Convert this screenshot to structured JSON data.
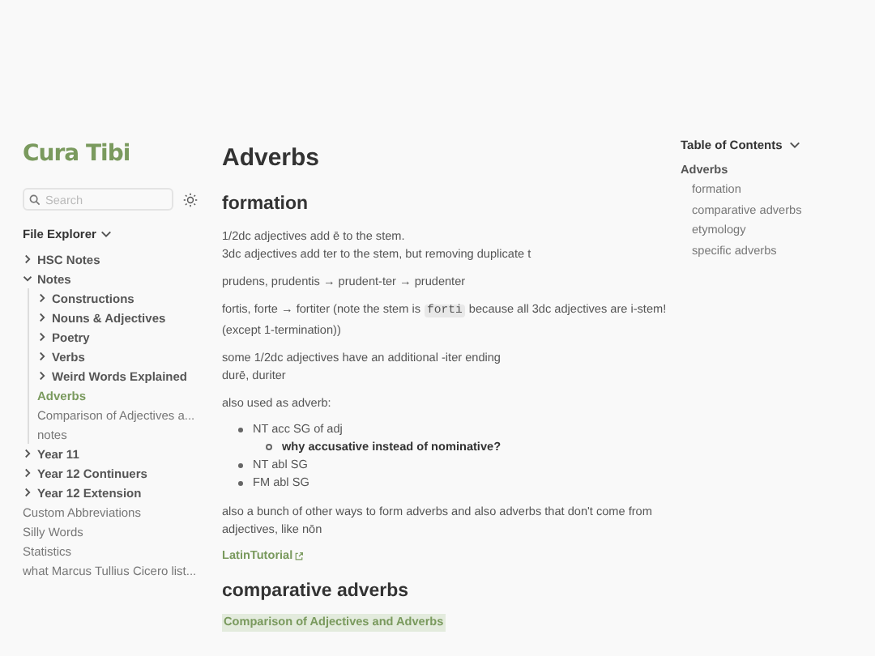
{
  "sidebar": {
    "logo": "Cura Tibi",
    "search": {
      "placeholder": "Search"
    },
    "explorer_title": "File Explorer",
    "tree": [
      {
        "label": "HSC Notes",
        "kind": "folder",
        "expanded": false,
        "selected": false
      },
      {
        "label": "Notes",
        "kind": "folder",
        "expanded": true,
        "selected": false,
        "children": [
          {
            "label": "Constructions",
            "kind": "folder",
            "expanded": false,
            "selected": false
          },
          {
            "label": "Nouns & Adjectives",
            "kind": "folder",
            "expanded": false,
            "selected": false
          },
          {
            "label": "Poetry",
            "kind": "folder",
            "expanded": false,
            "selected": false
          },
          {
            "label": "Verbs",
            "kind": "folder",
            "expanded": false,
            "selected": false
          },
          {
            "label": "Weird Words Explained",
            "kind": "folder",
            "expanded": false,
            "selected": false
          },
          {
            "label": "Adverbs",
            "kind": "file",
            "selected": true
          },
          {
            "label": "Comparison of Adjectives a...",
            "kind": "file",
            "selected": false
          },
          {
            "label": "notes",
            "kind": "file",
            "selected": false
          }
        ]
      },
      {
        "label": "Year 11",
        "kind": "folder",
        "expanded": false,
        "selected": false
      },
      {
        "label": "Year 12 Continuers",
        "kind": "folder",
        "expanded": false,
        "selected": false
      },
      {
        "label": "Year 12 Extension",
        "kind": "folder",
        "expanded": false,
        "selected": false
      },
      {
        "label": "Custom Abbreviations",
        "kind": "file",
        "selected": false
      },
      {
        "label": "Silly Words",
        "kind": "file",
        "selected": false
      },
      {
        "label": "Statistics",
        "kind": "file",
        "selected": false
      },
      {
        "label": "what Marcus Tullius Cicero list...",
        "kind": "file",
        "selected": false
      }
    ]
  },
  "article": {
    "title": "Adverbs",
    "blocks": [
      {
        "kind": "heading",
        "text": "formation"
      },
      {
        "kind": "para",
        "lines": [
          "1/2dc adjectives add ē to the stem.",
          "3dc adjectives add ter to the stem, but removing duplicate t"
        ]
      },
      {
        "kind": "para",
        "lines": [
          "prudens, prudentis → prudent-ter → prudenter"
        ]
      },
      {
        "kind": "code_para",
        "before": "fortis, forte → fortiter (note the stem is ",
        "code": "forti",
        "after": " because all 3dc adjectives are i-stem! (except 1-termination))"
      },
      {
        "kind": "para",
        "lines": [
          "some 1/2dc adjectives have an additional -iter ending",
          "durē, duriter"
        ]
      },
      {
        "kind": "para",
        "lines": [
          "also used as adverb:"
        ]
      },
      {
        "kind": "list",
        "items": [
          {
            "text": "NT acc SG of adj",
            "children": [
              {
                "text": "why accusative instead of nominative?"
              }
            ]
          },
          {
            "text": "NT abl SG"
          },
          {
            "text": "FM abl SG"
          }
        ]
      },
      {
        "kind": "para",
        "lines": [
          "also a bunch of other ways to form adverbs and also adverbs that don't come from adjectives, like nōn"
        ]
      },
      {
        "kind": "external_link",
        "text": "LatinTutorial"
      },
      {
        "kind": "heading",
        "text": "comparative adverbs"
      },
      {
        "kind": "internal_link",
        "text": "Comparison of Adjectives and Adverbs"
      }
    ]
  },
  "toc": {
    "title": "Table of Contents",
    "items": [
      {
        "label": "Adverbs",
        "selected": true,
        "children": [
          {
            "label": "formation",
            "selected": false
          },
          {
            "label": "comparative adverbs",
            "selected": false
          },
          {
            "label": "etymology",
            "selected": false
          },
          {
            "label": "specific adverbs",
            "selected": false
          }
        ]
      }
    ]
  }
}
